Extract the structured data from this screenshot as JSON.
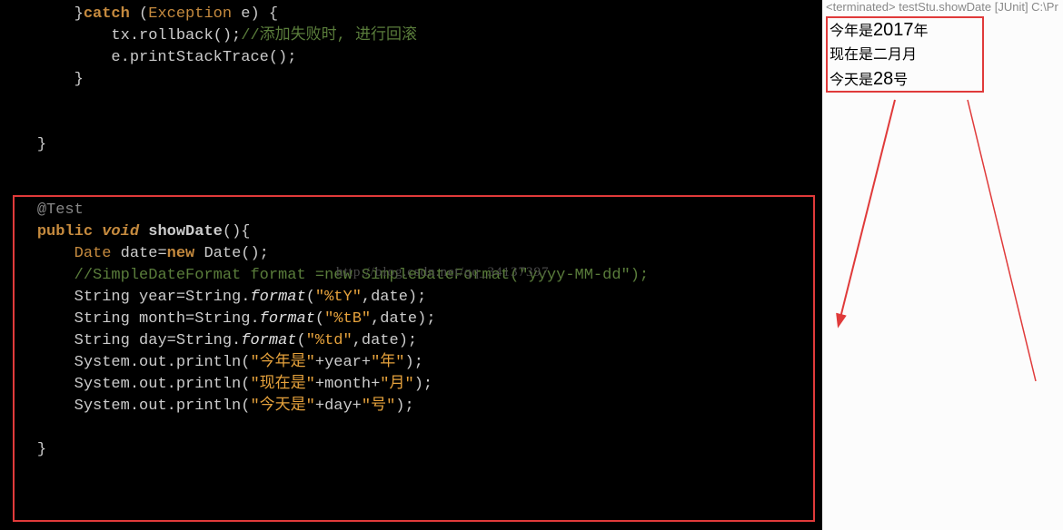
{
  "watermark": "http://blog.csdn.net/qq_34137397",
  "code": {
    "l1": {
      "a": "}",
      "b": "catch",
      "c": " (",
      "d": "Exception",
      "e": " e) {"
    },
    "l2": {
      "a": "tx.rollback();",
      "b": "//添加失败时, 进行回滚"
    },
    "l3": "e.printStackTrace();",
    "l4": "}",
    "l5": "}",
    "l6": "@Test",
    "l7": {
      "a": "public",
      "b": "void",
      "c": "showDate",
      "d": "(){"
    },
    "l8": {
      "a": "Date",
      "b": " date=",
      "c": "new",
      "d": " Date();"
    },
    "l9": "//SimpleDateFormat format =new SimpleDateFormat(\"yyyy-MM-dd\");",
    "l10": {
      "a": "String year=String.",
      "b": "format",
      "c": "(",
      "d": "\"%tY\"",
      "e": ",date);"
    },
    "l11": {
      "a": "String month=String.",
      "b": "format",
      "c": "(",
      "d": "\"%tB\"",
      "e": ",date);"
    },
    "l12": {
      "a": "String day=String.",
      "b": "format",
      "c": "(",
      "d": "\"%td\"",
      "e": ",date);"
    },
    "l13": {
      "a": "System.out.println(",
      "b": "\"今年是\"",
      "c": "+year+",
      "d": "\"年\"",
      "e": ");"
    },
    "l14": {
      "a": "System.out.println(",
      "b": "\"现在是\"",
      "c": "+month+",
      "d": "\"月\"",
      "e": ");"
    },
    "l15": {
      "a": "System.out.println(",
      "b": "\"今天是\"",
      "c": "+day+",
      "d": "\"号\"",
      "e": ");"
    },
    "l16": "}"
  },
  "term_header": "<terminated> testStu.showDate [JUnit] C:\\Pr",
  "output": {
    "line1": {
      "a": "今年是",
      "b": "2017",
      "c": "年"
    },
    "line2": "现在是二月月",
    "line3": {
      "a": "今天是",
      "b": "28",
      "c": "号"
    }
  }
}
